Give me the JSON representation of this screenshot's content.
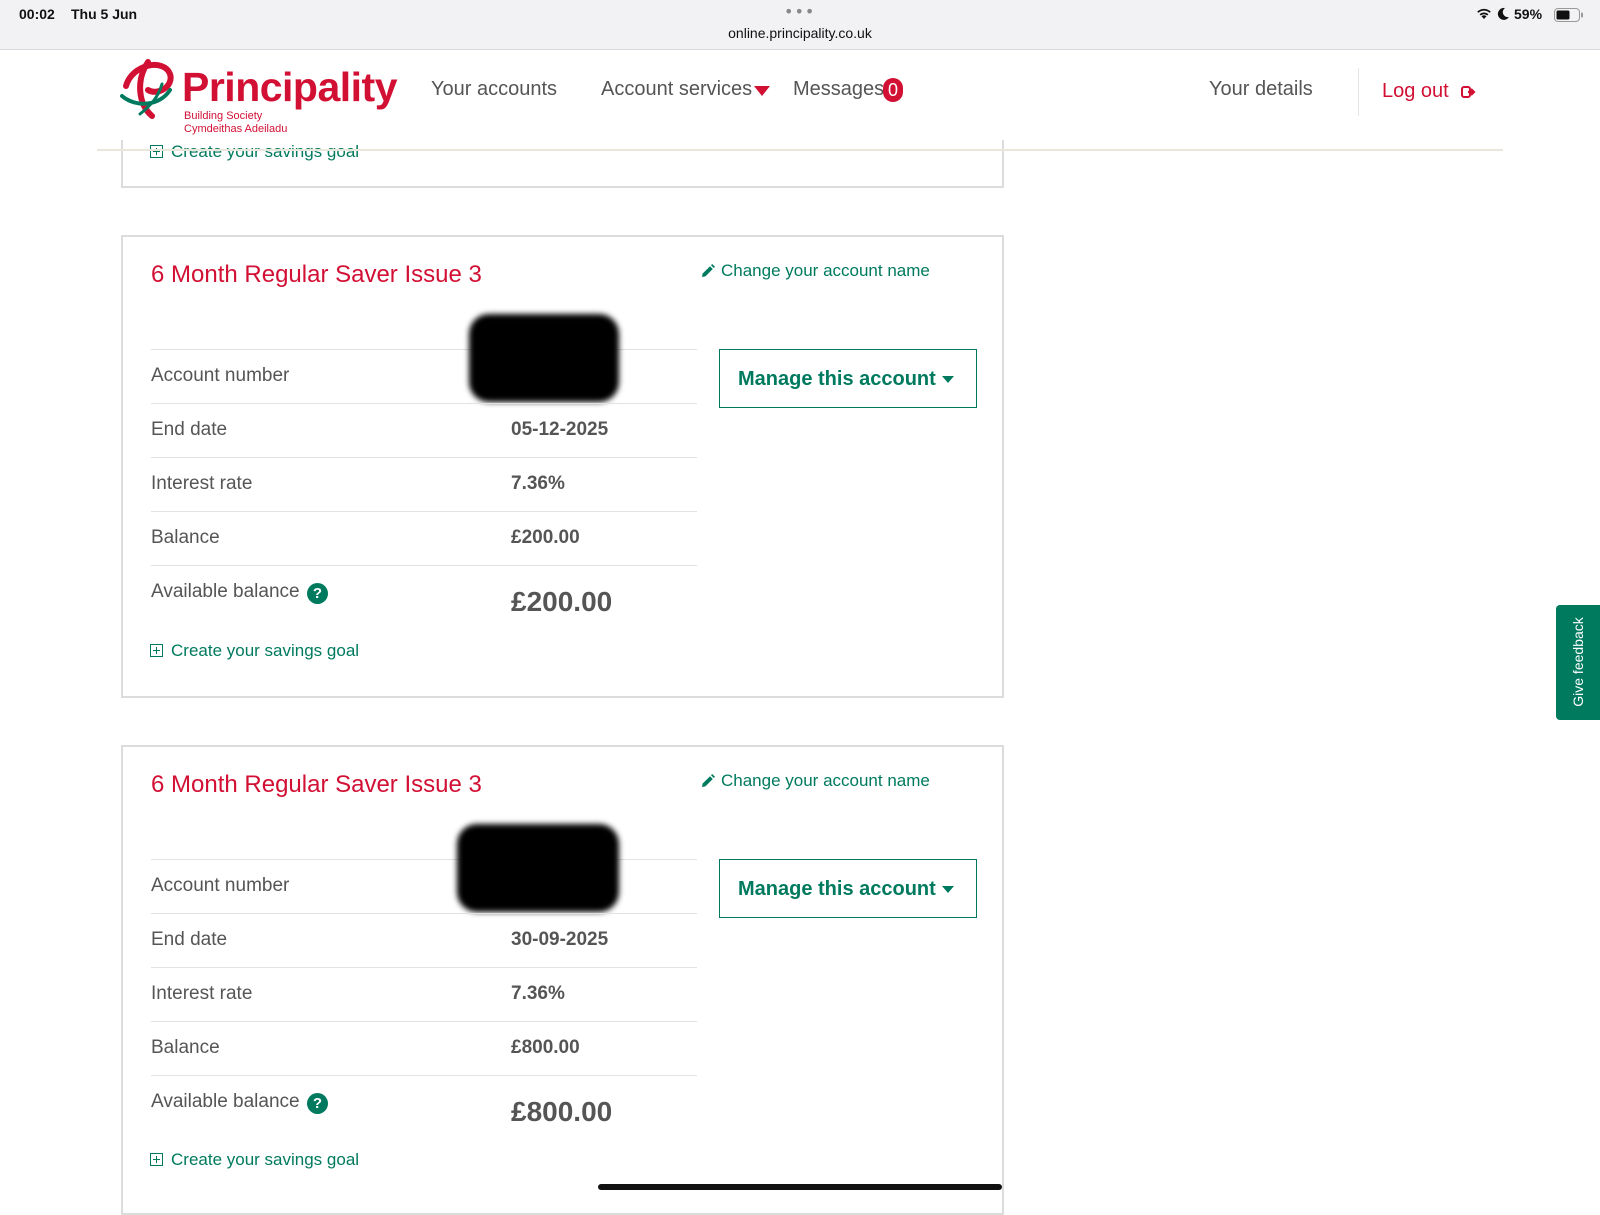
{
  "status_bar": {
    "time": "00:02",
    "date": "Thu 5 Jun",
    "url": "online.principality.co.uk",
    "battery": "59%"
  },
  "brand": {
    "name": "Principality",
    "sub1": "Building Society",
    "sub2": "Cymdeithas Adeiladu",
    "color": "#d21034"
  },
  "nav": {
    "your_accounts": "Your accounts",
    "account_services": "Account services",
    "messages": "Messages",
    "messages_count": "0",
    "your_details": "Your details",
    "log_out": "Log out"
  },
  "partial_card": {
    "goal_link": "Create your savings goal"
  },
  "accounts": [
    {
      "title": "6 Month Regular Saver Issue 3",
      "change_name": "Change your account name",
      "manage": "Manage this account",
      "labels": {
        "account_number": "Account number",
        "end_date": "End date",
        "interest_rate": "Interest rate",
        "balance": "Balance",
        "available_balance": "Available balance"
      },
      "end_date": "05-12-2025",
      "interest_rate": "7.36%",
      "balance": "£200.00",
      "available_balance": "£200.00",
      "goal_link": "Create your savings goal"
    },
    {
      "title": "6 Month Regular Saver Issue 3",
      "change_name": "Change your account name",
      "manage": "Manage this account",
      "labels": {
        "account_number": "Account number",
        "end_date": "End date",
        "interest_rate": "Interest rate",
        "balance": "Balance",
        "available_balance": "Available balance"
      },
      "end_date": "30-09-2025",
      "interest_rate": "7.36%",
      "balance": "£800.00",
      "available_balance": "£800.00",
      "goal_link": "Create your savings goal"
    }
  ],
  "feedback": "Give feedback",
  "accent_color": "#007a5e"
}
